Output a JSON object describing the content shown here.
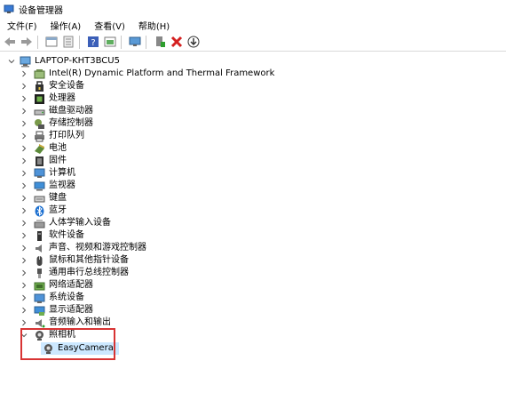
{
  "window": {
    "title": "设备管理器"
  },
  "menu": [
    "文件(F)",
    "操作(A)",
    "查看(V)",
    "帮助(H)"
  ],
  "toolbar": {
    "buttons": [
      "back-icon",
      "forward-icon",
      "properties-icon",
      "help-icon",
      "help-question-icon",
      "view-icon",
      "monitor-icon",
      "enable-device-icon",
      "uninstall-icon",
      "update-icon"
    ]
  },
  "tree": {
    "root": "LAPTOP-KHT3BCU5",
    "categories": [
      "Intel(R) Dynamic Platform and Thermal Framework",
      "安全设备",
      "处理器",
      "磁盘驱动器",
      "存储控制器",
      "打印队列",
      "电池",
      "固件",
      "计算机",
      "监视器",
      "键盘",
      "蓝牙",
      "人体学输入设备",
      "软件设备",
      "声音、视频和游戏控制器",
      "鼠标和其他指针设备",
      "通用串行总线控制器",
      "网络适配器",
      "系统设备",
      "显示适配器",
      "音频输入和输出",
      "照相机"
    ],
    "expanded_child": "EasyCamera"
  },
  "colors": {
    "highlight": "#d83434",
    "selected": "#cce8ff"
  }
}
